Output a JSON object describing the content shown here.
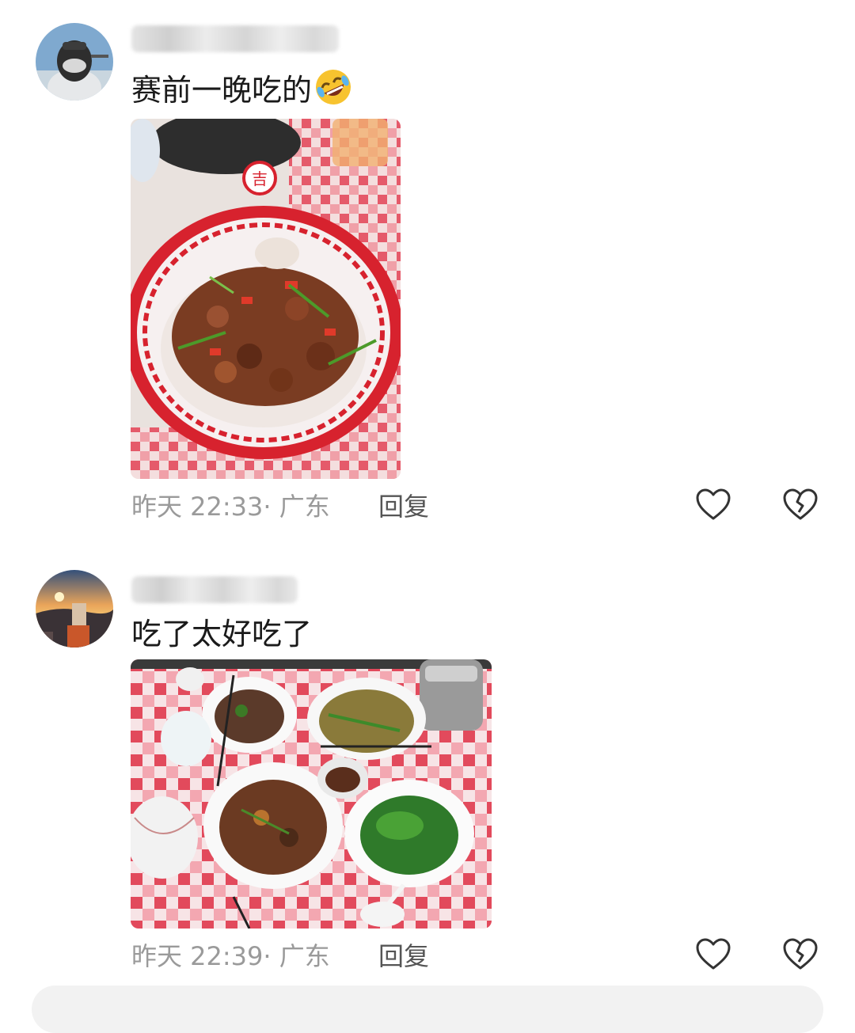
{
  "comments": [
    {
      "text": "赛前一晚吃的",
      "emoji": "rofl-emoji",
      "time": "昨天 22:33",
      "location": "广东",
      "reply_label": "回复",
      "photo": "stir-fried meat in red patterned bowl"
    },
    {
      "text": "吃了太好吃了",
      "time": "昨天 22:39",
      "location": "广东",
      "reply_label": "回复",
      "photo": "dinner table with several dishes"
    }
  ],
  "separator": "·",
  "icons": {
    "like": "heart-outline-icon",
    "dislike": "broken-heart-icon"
  },
  "colors": {
    "meta_text": "#9a9a9a",
    "body_text": "#1a1a1a",
    "reply_text": "#555555"
  }
}
